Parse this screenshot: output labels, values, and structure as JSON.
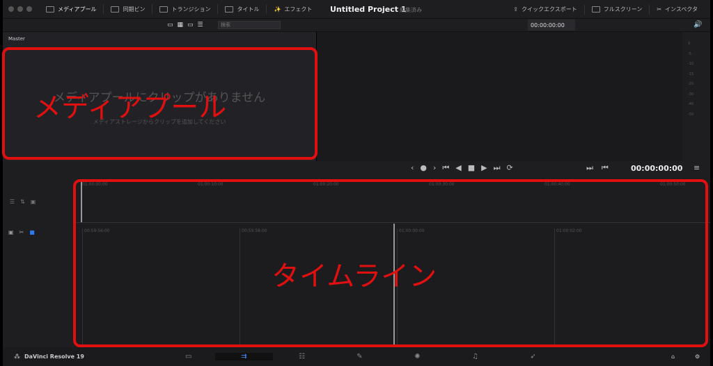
{
  "topbar": {
    "tabs": [
      "メディアプール",
      "同期ビン",
      "トランジション",
      "タイトル",
      "エフェクト"
    ],
    "project_title": "Untitled Project 1",
    "status": "編集済み",
    "right": [
      "クイックエクスポート",
      "フルスクリーン",
      "インスペクタ"
    ]
  },
  "media_pool": {
    "search_placeholder": "検索",
    "bin": "Master",
    "empty_title": "メディアプールにクリップがありません",
    "empty_sub": "メディアストレージからクリップを追加してください"
  },
  "viewer": {
    "timecode_top": "00:00:00:00",
    "timecode": "00:00:00:00"
  },
  "meter": {
    "labels": [
      "0",
      "-5",
      "-10",
      "-15",
      "-20",
      "-30",
      "-40",
      "-50"
    ]
  },
  "timeline": {
    "upper_ruler": [
      "01:00:00:00",
      "01:00:10:00",
      "01:00:20:00",
      "01:00:30:00",
      "01:00:40:00",
      "01:00:50:00"
    ],
    "lower_ruler": [
      "00:59:56:00",
      "00:59:58:00",
      "01:00:00:00",
      "01:00:02:00"
    ]
  },
  "annotations": {
    "media_pool": "メディアプール",
    "timeline": "タイムライン"
  },
  "bottom": {
    "app": "DaVinci Resolve 19"
  },
  "colors": {
    "annotation": "#e01010",
    "bg": "#1e1e21"
  }
}
